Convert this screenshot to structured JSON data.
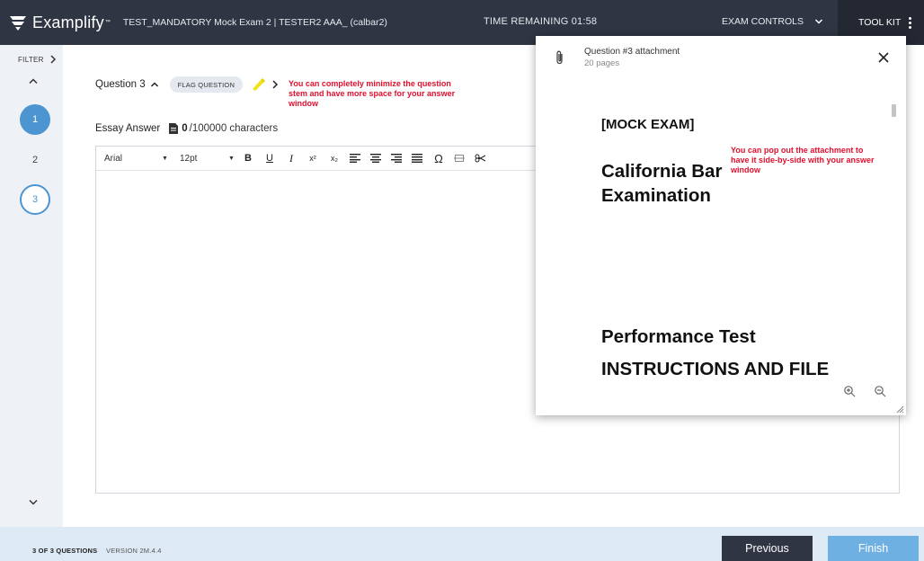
{
  "header": {
    "app_name": "Examplify",
    "trademark": "™",
    "exam_title": "TEST_MANDATORY Mock Exam 2 | TESTER2 AAA_ (calbar2)",
    "time_remaining": "TIME REMAINING 01:58",
    "exam_controls_label": "EXAM CONTROLS",
    "toolkit_label": "TOOL KIT"
  },
  "sidebar": {
    "filter_label": "FILTER",
    "questions": [
      {
        "number": "1",
        "state": "answered"
      },
      {
        "number": "2",
        "state": "unvisited"
      },
      {
        "number": "3",
        "state": "current"
      }
    ]
  },
  "question": {
    "label": "Question 3",
    "flag_label": "FLAG QUESTION",
    "annotation": "You can completely minimize the question stem and have more space for your answer window"
  },
  "essay": {
    "label": "Essay Answer",
    "char_count": "0",
    "char_max": "/100000 characters"
  },
  "toolbar": {
    "font": "Arial",
    "size": "12pt",
    "bold": "B",
    "underline": "U",
    "italic": "I",
    "superscript": "x²",
    "subscript": "x₂",
    "omega": "Ω"
  },
  "attachment": {
    "title": "Question #3 attachment",
    "pages": "20 pages",
    "doc_mock": "[MOCK EXAM]",
    "doc_title": "California Bar Examination",
    "doc_perf": "Performance Test",
    "doc_instr": "INSTRUCTIONS AND FILE",
    "annotation": "You can pop out the attachment to have it side-by-side with your answer window"
  },
  "footer": {
    "count": "3 OF 3 QUESTIONS",
    "version": "VERSION 2M.4.4",
    "previous_label": "Previous",
    "finish_label": "Finish"
  },
  "colors": {
    "topbar": "#2f3542",
    "accent_blue": "#4c95d1",
    "annotation_red": "#e0102e",
    "footer_bg": "#dde9f5",
    "finish_btn": "#6fb0e3"
  }
}
